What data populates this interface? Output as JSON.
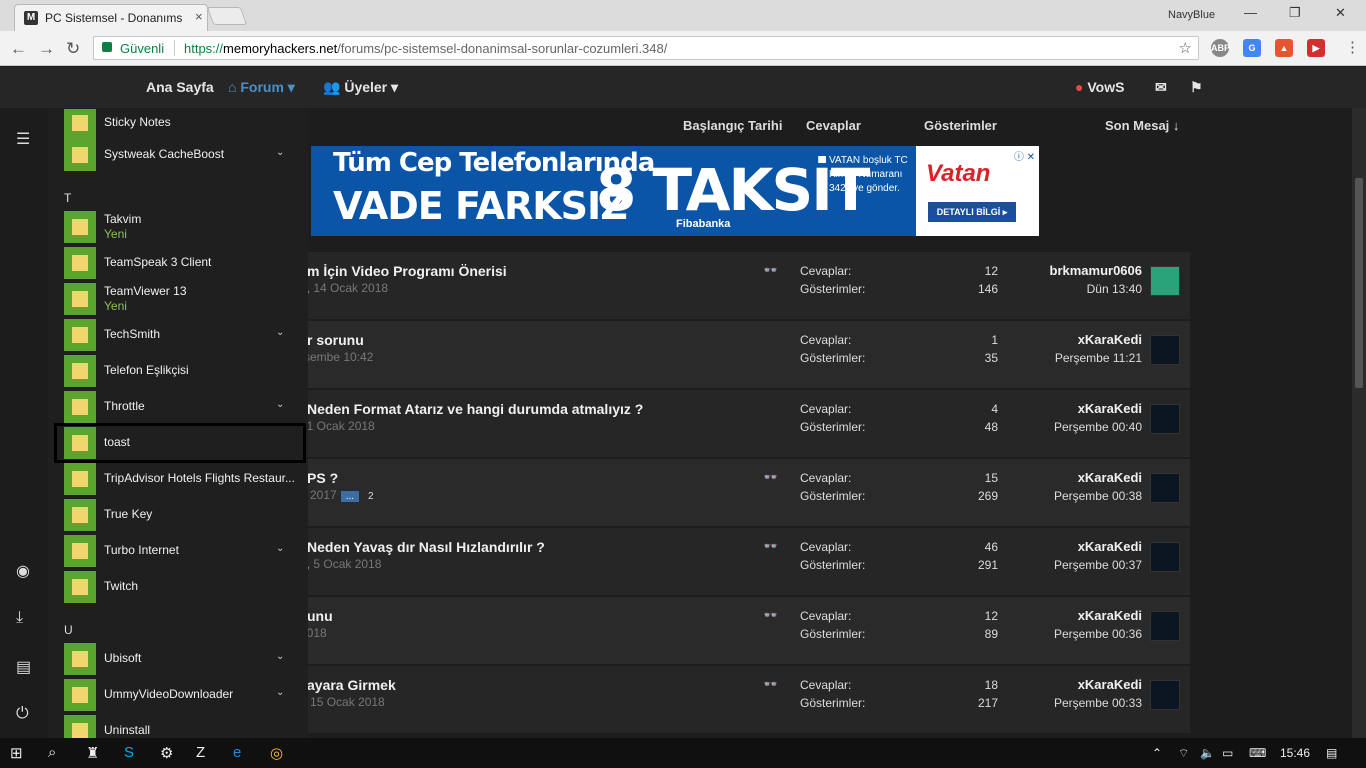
{
  "browser": {
    "tab_title": "PC Sistemsel - Donanıms",
    "tab_close": "×",
    "profile": "NavyBlue",
    "secure_label": "Güvenli",
    "url_scheme": "https://",
    "url_host": "memoryhackers.net",
    "url_path": "/forums/pc-sistemsel-donanimsal-sorunlar-cozumleri.348/",
    "ext_abp": "ABP"
  },
  "forum_nav": {
    "home": "Ana Sayfa",
    "forum": "Forum ▾",
    "members": "Üyeler ▾",
    "user": "VowS"
  },
  "columns": {
    "start_date": "Başlangıç Tarihi",
    "replies": "Cevaplar",
    "views": "Gösterimler",
    "last_msg": "Son Mesaj ↓"
  },
  "banner": {
    "line1": "Tüm Cep Telefonlarında",
    "line2": "VADE FARKSIZ",
    "big": "8 TAKSİT",
    "fibabanka": "Fibabanka",
    "sms": "VATAN boşluk TC Kimlik Numaranı 3422'ye gönder.",
    "vatan": "Vatan",
    "detail": "DETAYLI BİLGİ ▸",
    "ad": "ⓘ ✕"
  },
  "stat_labels": {
    "replies": "Cevaplar:",
    "views": "Gösterimler:"
  },
  "threads": [
    {
      "title": "m İçin Video Programı Önerisi",
      "meta": "6,",
      "date": "14 Ocak 2018",
      "replies": "12",
      "views": "146",
      "user": "brkmamur0606",
      "time": "Dün 13:40",
      "icon": true
    },
    {
      "title": "r sorunu",
      "meta": "",
      "date": "rşembe 10:42",
      "replies": "1",
      "views": "35",
      "user": "xKaraKedi",
      "time": "Perşembe 11:21",
      "icon": false
    },
    {
      "title": "Neden Format Atarız ve hangi durumda atmalıyız ?",
      "meta": "",
      "date": "21 Ocak 2018",
      "replies": "4",
      "views": "48",
      "user": "xKaraKedi",
      "time": "Perşembe 00:40",
      "icon": false
    },
    {
      "title": "PS ?",
      "meta": "",
      "date": "n 2017",
      "replies": "15",
      "views": "269",
      "user": "xKaraKedi",
      "time": "Perşembe 00:38",
      "icon": true,
      "pages": [
        "...",
        "2"
      ]
    },
    {
      "title": "Neden Yavaş dır Nasıl Hızlandırılır ?",
      "meta": "o,",
      "date": "5 Ocak 2018",
      "replies": "46",
      "views": "291",
      "user": "xKaraKedi",
      "time": "Perşembe 00:37",
      "icon": true
    },
    {
      "title": "unu",
      "meta": "",
      "date": "2018",
      "replies": "12",
      "views": "89",
      "user": "xKaraKedi",
      "time": "Perşembe 00:36",
      "icon": true
    },
    {
      "title": "ayara Girmek",
      "meta": "r,",
      "date": "15 Ocak 2018",
      "replies": "18",
      "views": "217",
      "user": "xKaraKedi",
      "time": "Perşembe 00:33",
      "icon": true
    }
  ],
  "start_menu": {
    "letters": [
      "T",
      "U"
    ],
    "apps": [
      {
        "name": "Sticky Notes",
        "sub": "",
        "chev": false
      },
      {
        "name": "Systweak CacheBoost",
        "sub": "",
        "chev": true
      },
      {
        "name": "Takvim",
        "sub": "Yeni",
        "chev": false
      },
      {
        "name": "TeamSpeak 3 Client",
        "sub": "",
        "chev": false
      },
      {
        "name": "TeamViewer 13",
        "sub": "Yeni",
        "chev": false
      },
      {
        "name": "TechSmith",
        "sub": "",
        "chev": true
      },
      {
        "name": "Telefon Eşlikçisi",
        "sub": "",
        "chev": false
      },
      {
        "name": "Throttle",
        "sub": "",
        "chev": true
      },
      {
        "name": "toast",
        "sub": "",
        "chev": false
      },
      {
        "name": "TripAdvisor Hotels Flights Restaur...",
        "sub": "",
        "chev": false
      },
      {
        "name": "True Key",
        "sub": "",
        "chev": false
      },
      {
        "name": "Turbo Internet",
        "sub": "",
        "chev": true
      },
      {
        "name": "Twitch",
        "sub": "",
        "chev": false
      },
      {
        "name": "Ubisoft",
        "sub": "",
        "chev": true
      },
      {
        "name": "UmmyVideoDownloader",
        "sub": "",
        "chev": true
      },
      {
        "name": "Uninstall",
        "sub": "",
        "chev": false
      }
    ]
  },
  "taskbar": {
    "time": "15:46"
  },
  "colors": {
    "accent": "#4a90c8",
    "tile_green": "#5aa62c",
    "new_green": "#8bc34a",
    "purple": "#9b59b6"
  }
}
